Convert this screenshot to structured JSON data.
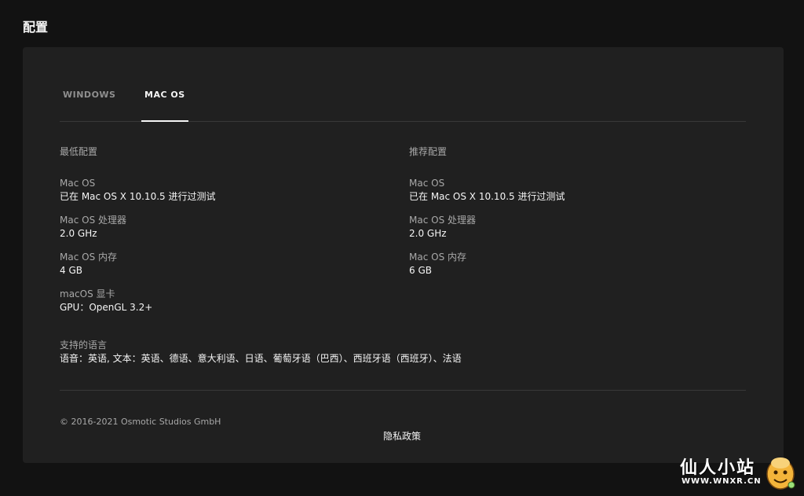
{
  "page": {
    "title": "配置"
  },
  "tabs": [
    {
      "label": "WINDOWS",
      "active": false
    },
    {
      "label": "MAC OS",
      "active": true
    }
  ],
  "minimum": {
    "heading": "最低配置",
    "specs": [
      {
        "label": "Mac OS",
        "value": "已在 Mac OS X 10.10.5 进行过测试"
      },
      {
        "label": "Mac OS 处理器",
        "value": "2.0 GHz"
      },
      {
        "label": "Mac OS 内存",
        "value": "4 GB"
      },
      {
        "label": "macOS 显卡",
        "value": "GPU：OpenGL 3.2+"
      }
    ]
  },
  "recommended": {
    "heading": "推荐配置",
    "specs": [
      {
        "label": "Mac OS",
        "value": "已在 Mac OS X 10.10.5 进行过测试"
      },
      {
        "label": "Mac OS 处理器",
        "value": "2.0 GHz"
      },
      {
        "label": "Mac OS 内存",
        "value": "6 GB"
      }
    ]
  },
  "languages": {
    "label": "支持的语言",
    "value": "语音：英语, 文本：英语、德语、意大利语、日语、葡萄牙语（巴西）、西班牙语（西班牙）、法语"
  },
  "footer": {
    "copyright": "© 2016-2021 Osmotic Studios GmbH",
    "privacy_label": "隐私政策"
  },
  "watermark": {
    "title": "仙人小站",
    "url": "WWW.WNXR.CN"
  },
  "colors": {
    "background": "#121212",
    "panel": "#202020",
    "text_primary": "#f5f5f5",
    "text_secondary": "#a8a8a8",
    "divider": "#383838"
  }
}
